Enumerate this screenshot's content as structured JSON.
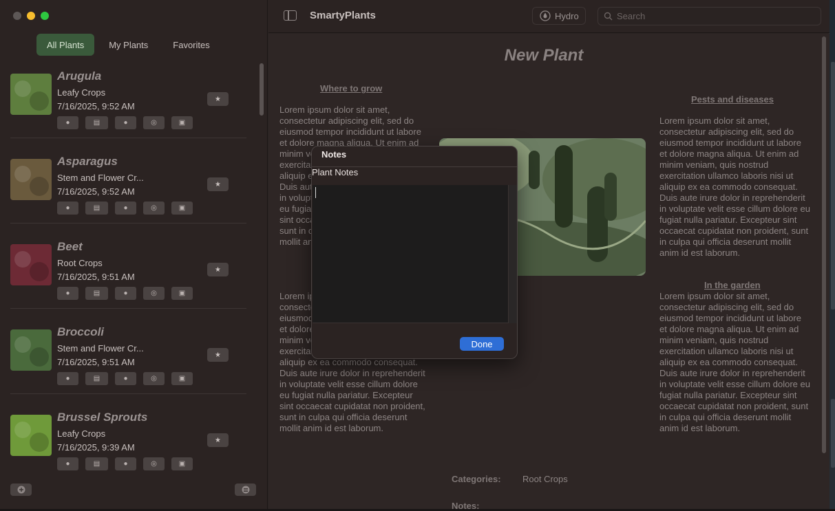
{
  "app": {
    "title": "SmartyPlants"
  },
  "window_controls": {
    "close_color": "#5d5756",
    "minimize_color": "#f7bd2e",
    "zoom_color": "#2ec740"
  },
  "sidebar": {
    "tabs": [
      {
        "label": "All Plants",
        "selected": true
      },
      {
        "label": "My Plants",
        "selected": false
      },
      {
        "label": "Favorites",
        "selected": false
      }
    ],
    "plants": [
      {
        "name": "Arugula",
        "category": "Leafy Crops",
        "date": "7/16/2025, 9:52 AM",
        "thumb_color": "#5e7e3e"
      },
      {
        "name": "Asparagus",
        "category": "Stem and Flower Cr...",
        "date": "7/16/2025, 9:52 AM",
        "thumb_color": "#6a5a3d"
      },
      {
        "name": "Beet",
        "category": " Root Crops",
        "date": "7/16/2025, 9:51 AM",
        "thumb_color": "#6d2a35"
      },
      {
        "name": "Broccoli",
        "category": "Stem and Flower Cr...",
        "date": "7/16/2025, 9:51 AM",
        "thumb_color": "#4a6a3c"
      },
      {
        "name": "Brussel Sprouts",
        "category": "Leafy Crops",
        "date": "7/16/2025, 9:39 AM",
        "thumb_color": "#6f9a3a"
      }
    ]
  },
  "toolbar": {
    "hydro_label": "Hydro",
    "search_placeholder": "Search"
  },
  "detail": {
    "title": "New Plant",
    "where_to_grow_heading": "Where to grow",
    "pests_heading": "Pests and diseases",
    "garden_heading": "In the garden",
    "where_to_grow_text": "Lorem ipsum dolor sit amet, consectetur adipiscing elit, sed do eiusmod tempor incididunt ut labore et dolore magna aliqua. Ut enim ad minim veniam, quis nostrud exercitation ullamco laboris nisi ut aliquip ex ea commodo consequat. Duis aute irure dolor in reprehenderit in voluptate velit esse cillum dolore eu fugiat nulla pariatur. Excepteur sint occaecat cupidatat non proident, sunt in culpa qui officia deserunt mollit anim id est laborum.",
    "left_second_text": "Lorem ipsum dolor sit amet, consectetur adipiscing elit, sed do eiusmod tempor incididunt ut labore et dolore magna aliqua. Ut enim ad minim veniam, quis nostrud exercitation ullamco laboris nisi ut aliquip ex ea commodo consequat. Duis aute irure dolor in reprehenderit in voluptate velit esse cillum dolore eu fugiat nulla pariatur. Excepteur sint occaecat cupidatat non proident, sunt in culpa qui officia deserunt mollit anim id est laborum.",
    "pests_text": "Lorem ipsum dolor sit amet, consectetur adipiscing elit, sed do eiusmod tempor incididunt ut labore et dolore magna aliqua. Ut enim ad minim veniam, quis nostrud exercitation ullamco laboris nisi ut aliquip ex ea commodo consequat. Duis aute irure dolor in reprehenderit in voluptate velit esse cillum dolore eu fugiat nulla pariatur. Excepteur sint occaecat cupidatat non proident, sunt in culpa qui officia deserunt mollit anim id est laborum.",
    "garden_text": "Lorem ipsum dolor sit amet, consectetur adipiscing elit, sed do eiusmod tempor incididunt ut labore et dolore magna aliqua. Ut enim ad minim veniam, quis nostrud exercitation ullamco laboris nisi ut aliquip ex ea commodo consequat. Duis aute irure dolor in reprehenderit in voluptate velit esse cillum dolore eu fugiat nulla pariatur. Excepteur sint occaecat cupidatat non proident, sunt in culpa qui officia deserunt mollit anim id est laborum.",
    "categories_label": "Categories:",
    "categories_value": "Root Crops",
    "notes_label": "Notes:"
  },
  "modal": {
    "title": "Notes",
    "subtitle": "Plant Notes",
    "text_value": "",
    "done_label": "Done",
    "accent": "#2e6ed6"
  }
}
